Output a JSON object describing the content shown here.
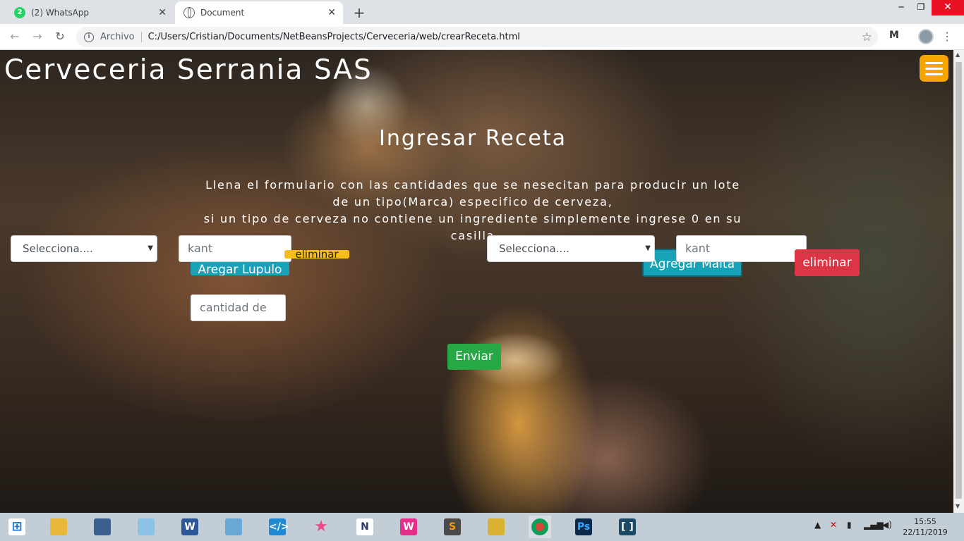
{
  "browser": {
    "tabs": [
      {
        "label": "(2) WhatsApp",
        "badge": "2"
      },
      {
        "label": "Document"
      }
    ],
    "new_tab": "+",
    "address": {
      "scheme_label": "Archivo",
      "url": "C:/Users/Cristian/Documents/NetBeansProjects/Cerveceria/web/crearReceta.html"
    },
    "window_controls": {
      "minimize": "─",
      "maximize": "❐",
      "close": "✕"
    }
  },
  "page": {
    "site_title": "Cerveceria Serrania SAS",
    "heading": "Ingresar Receta",
    "description_lines": [
      "Llena el formulario con las cantidades que se nesecitan para producir un lote",
      "de un tipo(Marca) especifico de cerveza,",
      "si un tipo de cerveza no contiene un ingrediente simplemente ingrese 0 en su",
      "casilla"
    ],
    "lupulo": {
      "select_value": "Selecciona....",
      "qty_placeholder": "kant",
      "add_button": "Aregar Lupulo",
      "remove_button": "eliminar",
      "extra_placeholder": "cantidad de"
    },
    "malta": {
      "select_value": "Selecciona....",
      "qty_placeholder": "kant",
      "add_button": "Agregar Malta",
      "remove_button": "eliminar"
    },
    "submit_button": "Enviar"
  },
  "taskbar": {
    "apps": [
      "windows-start",
      "file-explorer",
      "app-bird",
      "app-notepad",
      "word",
      "app-cube",
      "vscode",
      "app-star",
      "app-graph",
      "wamp",
      "sublime",
      "app-folders",
      "chrome",
      "photoshop",
      "app-brackets"
    ],
    "clock_time": "15:55",
    "clock_date": "22/11/2019"
  }
}
